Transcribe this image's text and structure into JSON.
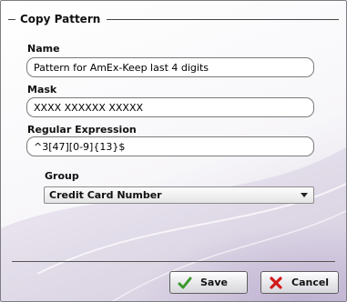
{
  "dialog": {
    "title": "Copy Pattern"
  },
  "form": {
    "name_label": "Name",
    "name_value": "Pattern for AmEx-Keep last 4 digits",
    "mask_label": "Mask",
    "mask_value": "XXXX XXXXXX XXXXX",
    "regex_label": "Regular Expression",
    "regex_value": "^3[47][0-9]{13}$",
    "group_label": "Group",
    "group_selected": "Credit Card Number"
  },
  "buttons": {
    "save_label": "Save",
    "cancel_label": "Cancel"
  },
  "colors": {
    "save_icon": "#3a9a2a",
    "cancel_icon": "#d11a1a",
    "accent_gradient": "#d9d3e3"
  }
}
